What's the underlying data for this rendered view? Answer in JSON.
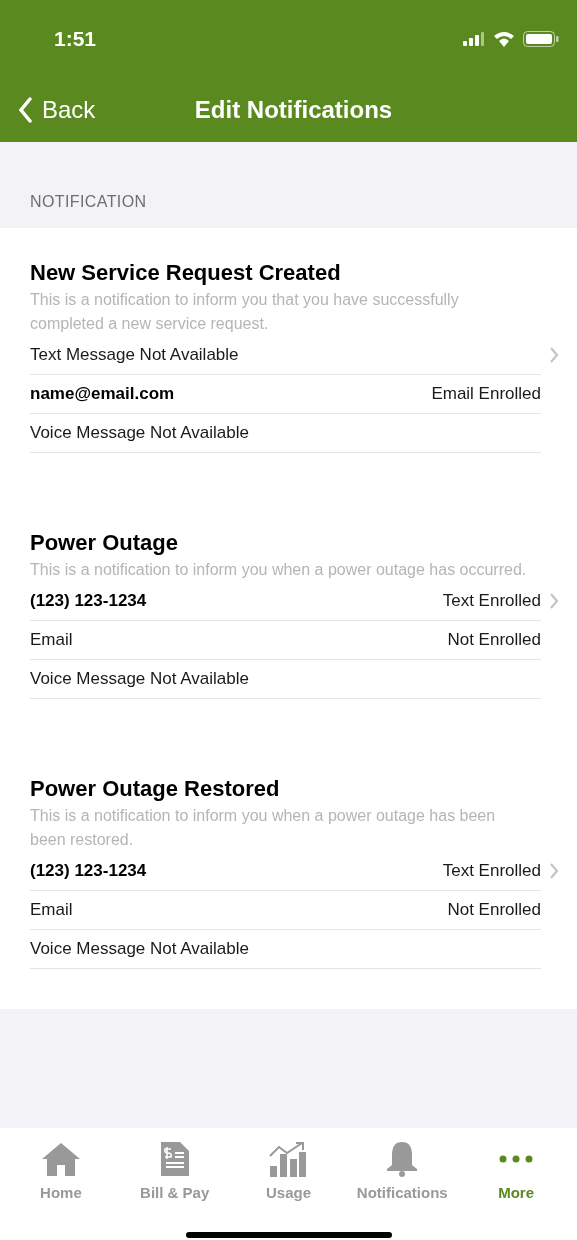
{
  "status_bar": {
    "time": "1:51"
  },
  "nav": {
    "back": "Back",
    "title": "Edit Notifications"
  },
  "section_header": "NOTIFICATION",
  "notifications": [
    {
      "title": "New Service Request Created",
      "description": "This is a notification to inform you that you have successfully completed a new service request.",
      "rows": [
        {
          "label": "Text Message Not Available",
          "emphasis": false,
          "chevron": true
        },
        {
          "label": "name@email.com",
          "emphasis": true,
          "status": "Email Enrolled",
          "chevron": false
        },
        {
          "label": "Voice Message Not Available",
          "emphasis": false,
          "chevron": false
        }
      ]
    },
    {
      "title": "Power Outage",
      "description": "This is a notification to inform you when a power outage has occurred.",
      "rows": [
        {
          "label": "(123) 123-1234",
          "emphasis": true,
          "status": "Text Enrolled",
          "chevron": true
        },
        {
          "label": "Email",
          "emphasis": false,
          "status": "Not Enrolled",
          "chevron": false
        },
        {
          "label": "Voice Message Not Available",
          "emphasis": false,
          "chevron": false
        }
      ]
    },
    {
      "title": "Power Outage Restored",
      "description": "This is a notification to inform you when a power outage has been been restored.",
      "rows": [
        {
          "label": "(123) 123-1234",
          "emphasis": true,
          "status": "Text Enrolled",
          "chevron": true
        },
        {
          "label": "Email",
          "emphasis": false,
          "status": "Not Enrolled",
          "chevron": false
        },
        {
          "label": "Voice Message Not Available",
          "emphasis": false,
          "chevron": false
        }
      ]
    }
  ],
  "tab_bar": [
    {
      "label": "Home",
      "kind": "home",
      "selected": false
    },
    {
      "label": "Bill & Pay",
      "kind": "bill",
      "selected": false
    },
    {
      "label": "Usage",
      "kind": "usage",
      "selected": false
    },
    {
      "label": "Notifications",
      "kind": "bell",
      "selected": false
    },
    {
      "label": "More",
      "kind": "more",
      "selected": true
    }
  ]
}
